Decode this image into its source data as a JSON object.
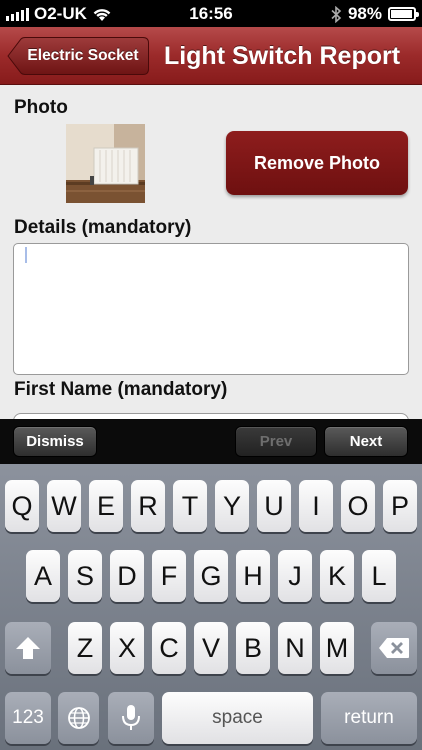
{
  "status_bar": {
    "carrier": "O2-UK",
    "time": "16:56",
    "battery": "98%",
    "battery_level": 0.98
  },
  "nav": {
    "back_label": "Electric Socket",
    "title": "Light Switch Report"
  },
  "form": {
    "photo_label": "Photo",
    "remove_photo_label": "Remove Photo",
    "details_label": "Details (mandatory)",
    "details_value": "",
    "first_name_label": "First Name (mandatory)"
  },
  "toolbar": {
    "dismiss": "Dismiss",
    "prev": "Prev",
    "next": "Next"
  },
  "keyboard": {
    "row1": [
      "Q",
      "W",
      "E",
      "R",
      "T",
      "Y",
      "U",
      "I",
      "O",
      "P"
    ],
    "row2": [
      "A",
      "S",
      "D",
      "F",
      "G",
      "H",
      "J",
      "K",
      "L"
    ],
    "row3": [
      "Z",
      "X",
      "C",
      "V",
      "B",
      "N",
      "M"
    ],
    "numbers": "123",
    "space": "space",
    "return": "return"
  },
  "colors": {
    "nav_red": "#9b2a2a",
    "button_red": "#7e1717"
  }
}
